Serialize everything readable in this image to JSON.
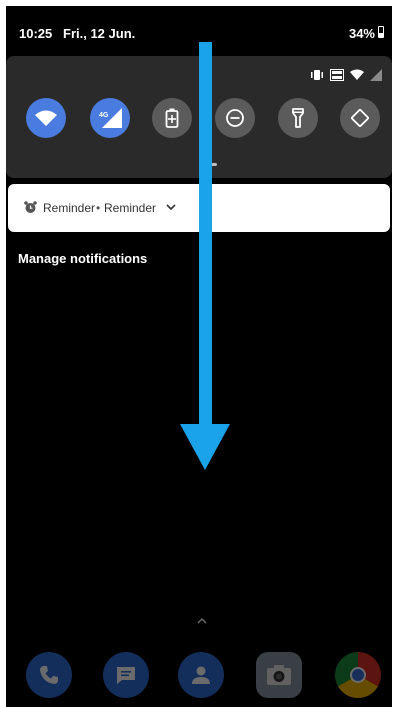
{
  "status_bar": {
    "time": "10:25",
    "date": "Fri., 12 Jun.",
    "battery": "34%"
  },
  "quick_settings": {
    "status_icons": [
      "vibrate-icon",
      "volte-icon",
      "wifi-icon",
      "signal-icon"
    ],
    "tiles": [
      {
        "name": "wifi-tile",
        "icon": "wifi-icon",
        "active": true
      },
      {
        "name": "mobile-data-tile",
        "icon": "mobile-data-icon",
        "label": "4G",
        "active": true
      },
      {
        "name": "battery-saver-tile",
        "icon": "battery-plus-icon",
        "active": false
      },
      {
        "name": "do-not-disturb-tile",
        "icon": "minus-circle-icon",
        "active": false
      },
      {
        "name": "flashlight-tile",
        "icon": "flashlight-icon",
        "active": false
      },
      {
        "name": "auto-rotate-tile",
        "icon": "rotate-icon",
        "active": false
      }
    ]
  },
  "notification": {
    "icon": "alarm-clock-icon",
    "app": "Reminder",
    "separator": "•",
    "title": "Reminder",
    "expand_icon": "chevron-down-icon"
  },
  "manage_label": "Manage notifications",
  "overlay": {
    "icon": "swipe-down-arrow-icon",
    "color": "#1aa3e8"
  },
  "dock": {
    "apps": [
      "phone-icon",
      "messages-icon",
      "contacts-icon",
      "camera-icon",
      "chrome-icon"
    ]
  },
  "colors": {
    "accent": "#4a7bdf",
    "panel": "#2a2a2a",
    "inactive_tile": "#5b5b5b"
  }
}
